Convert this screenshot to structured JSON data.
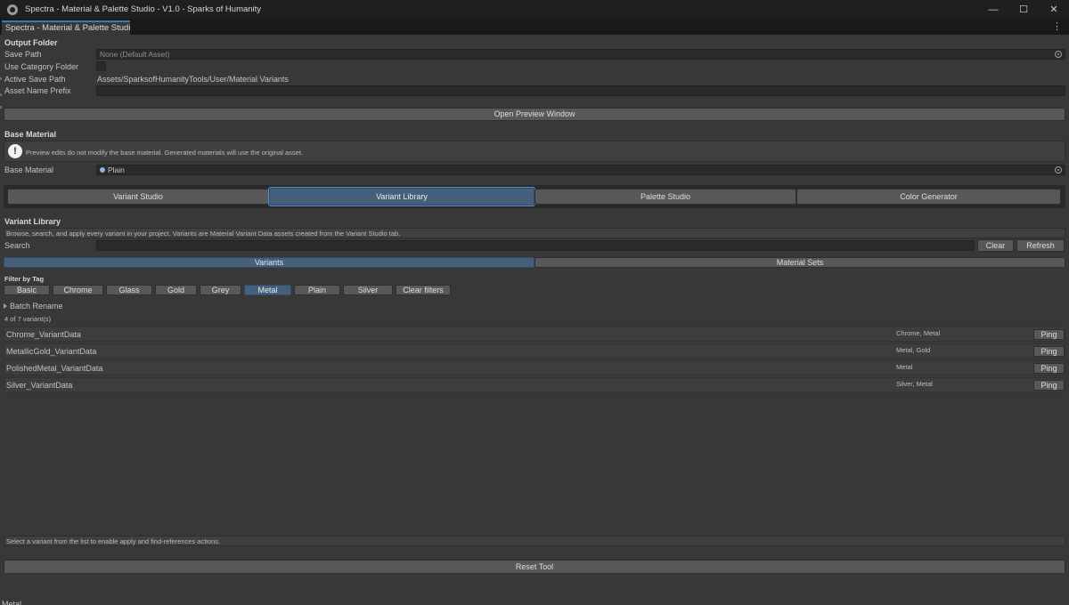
{
  "window": {
    "title": "Spectra - Material & Palette Studio -  V1.0 - Sparks of Humanity",
    "minimize": "—",
    "maximize": "☐",
    "close": "✕"
  },
  "tab": {
    "label": "Spectra - Material & Palette Studi...",
    "menu": "⋮"
  },
  "output_folder": {
    "header": "Output Folder",
    "save_path_label": "Save Path",
    "save_path_value": "None (Default Asset)",
    "use_category_label": "Use Category Folder",
    "use_category_checked": false,
    "active_save_label": "Active Save Path",
    "active_save_value": "Assets/SparksofHumanityTools/User/Material Variants",
    "prefix_label": "Asset Name Prefix",
    "prefix_value": ""
  },
  "open_preview_button": "Open Preview Window",
  "base_material": {
    "header": "Base Material",
    "help_text": "Preview edits do not modify the base material. Generated materials will use the original asset.",
    "field_label": "Base Material",
    "field_value": "Plain"
  },
  "main_tabs": [
    {
      "label": "Variant Studio",
      "active": false
    },
    {
      "label": "Variant Library",
      "active": true
    },
    {
      "label": "Palette Studio",
      "active": false
    },
    {
      "label": "Color Generator",
      "active": false
    }
  ],
  "library": {
    "header": "Variant Library",
    "description": "Browse, search, and apply every variant in your project. Variants are Material Variant Data assets created from the Variant Studio tab.",
    "search_label": "Search",
    "search_value": "",
    "clear_button": "Clear",
    "refresh_button": "Refresh",
    "sub_tabs": [
      {
        "label": "Variants",
        "active": true
      },
      {
        "label": "Material Sets",
        "active": false
      }
    ],
    "filter_label": "Filter by Tag",
    "tags": [
      {
        "label": "Basic",
        "active": false
      },
      {
        "label": "Chrome",
        "active": false
      },
      {
        "label": "Glass",
        "active": false
      },
      {
        "label": "Gold",
        "active": false
      },
      {
        "label": "Grey",
        "active": false
      },
      {
        "label": "Metal",
        "active": true
      },
      {
        "label": "Plain",
        "active": false
      },
      {
        "label": "Silver",
        "active": false
      }
    ],
    "clear_filters": "Clear filters",
    "batch_rename": "Batch Rename",
    "count_text": "4 of 7 variant(s)",
    "variants": [
      {
        "name": "Chrome_VariantData",
        "tags": "Chrome, Metal",
        "action": "Ping"
      },
      {
        "name": "MetallicGold_VariantData",
        "tags": "Metal, Gold",
        "action": "Ping"
      },
      {
        "name": "PolishedMetal_VariantData",
        "tags": "Metal",
        "action": "Ping"
      },
      {
        "name": "Silver_VariantData",
        "tags": "Silver, Metal",
        "action": "Ping"
      }
    ],
    "status_text": "Select a variant from the list to enable apply and find-references actions."
  },
  "reset_button": "Reset Tool",
  "footer_text": "Metal",
  "colors": {
    "accent": "#46607c",
    "panel": "#383838",
    "titlebar": "#1f1f1f"
  }
}
